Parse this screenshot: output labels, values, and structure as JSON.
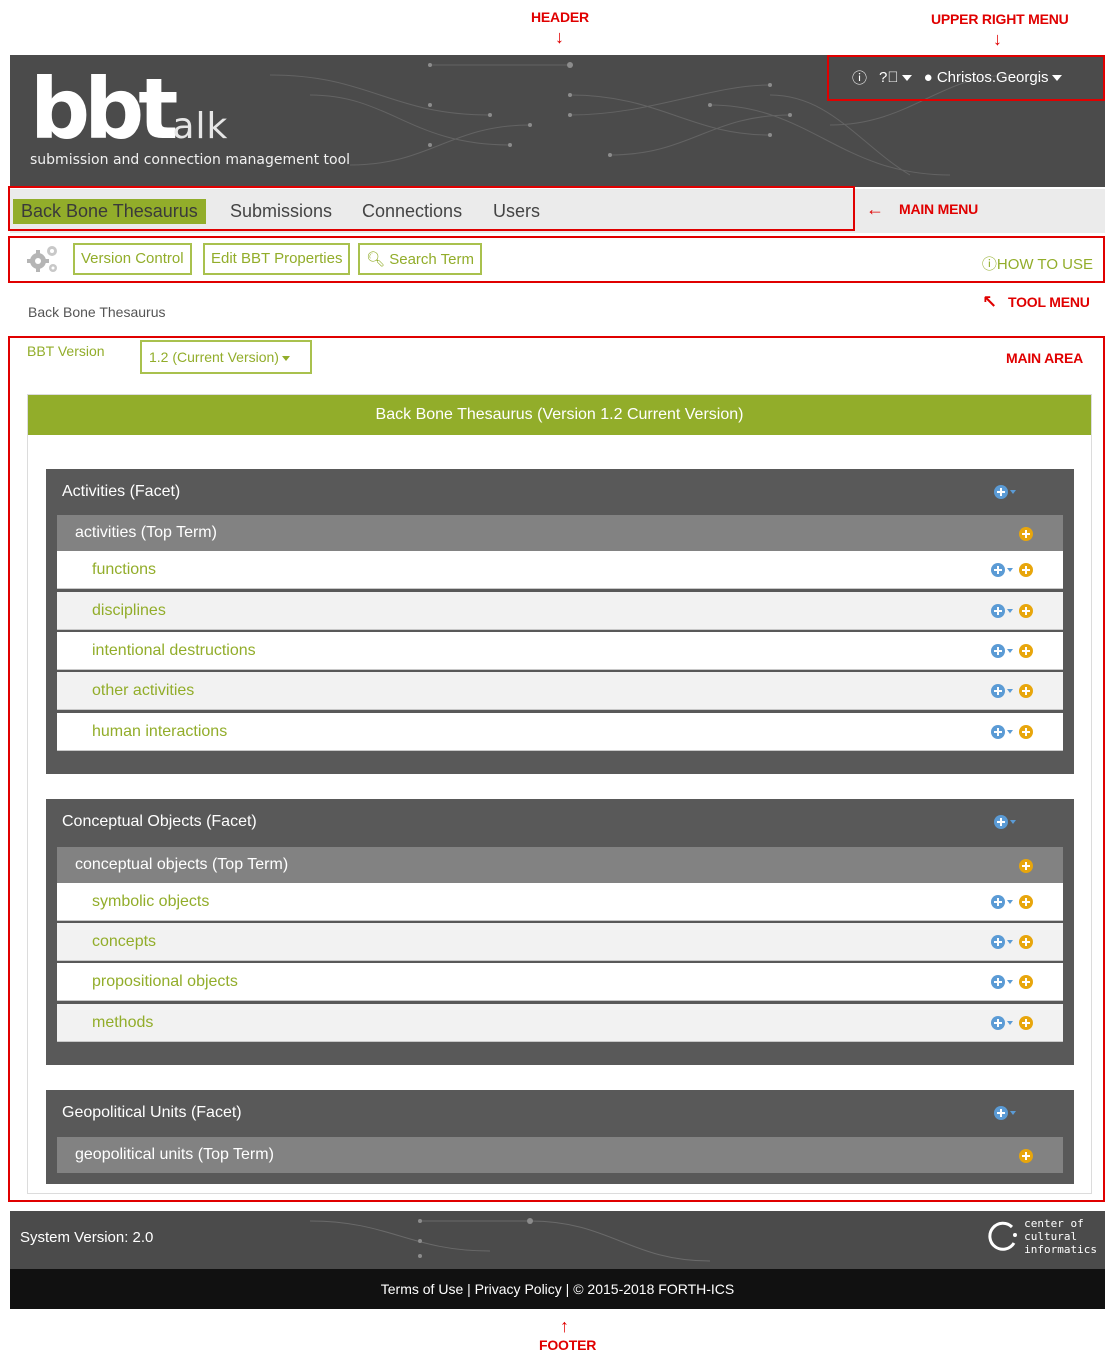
{
  "annotations": {
    "header": "HEADER",
    "upper_right_menu": "UPPER RIGHT MENU",
    "main_menu": "MAIN MENU",
    "tool_menu": "TOOL MENU",
    "main_area": "MAIN AREA",
    "footer": "FOOTER"
  },
  "header": {
    "logo_main": "bbt",
    "logo_suffix": "alk",
    "tagline": "submission and connection management tool",
    "user": "Christos.Georgis"
  },
  "main_menu": [
    "Back Bone Thesaurus",
    "Submissions",
    "Connections",
    "Users"
  ],
  "tool_menu": {
    "buttons": [
      "Version Control",
      "Edit BBT Properties",
      "Search Term"
    ],
    "how_to_use": "HOW TO USE"
  },
  "breadcrumb": "Back Bone Thesaurus",
  "version": {
    "label": "BBT Version",
    "selected": "1.2 (Current Version)"
  },
  "panel_title": "Back Bone Thesaurus (Version 1.2 Current Version)",
  "facets": [
    {
      "name": "Activities (Facet)",
      "top_term": "activities (Top Term)",
      "terms": [
        "functions",
        "disciplines",
        "intentional destructions",
        "other activities",
        "human interactions"
      ]
    },
    {
      "name": "Conceptual Objects (Facet)",
      "top_term": "conceptual objects (Top Term)",
      "terms": [
        "symbolic objects",
        "concepts",
        "propositional objects",
        "methods"
      ]
    },
    {
      "name": "Geopolitical Units (Facet)",
      "top_term": "geopolitical units (Top Term)",
      "terms": []
    }
  ],
  "footer": {
    "system_version": "System Version: 2.0",
    "cci": [
      "center of",
      "cultural",
      "informatics"
    ],
    "terms": "Terms of Use",
    "privacy": "Privacy Policy",
    "copyright": "© 2015-2018 FORTH-ICS"
  },
  "colors": {
    "accent": "#92ad2a",
    "annotation": "#e00000",
    "header_bg": "#4b4b4b",
    "facet_bg": "#595959",
    "topterm_bg": "#828282",
    "blue_icon": "#5b9bd5",
    "orange_icon": "#e8a60c"
  }
}
